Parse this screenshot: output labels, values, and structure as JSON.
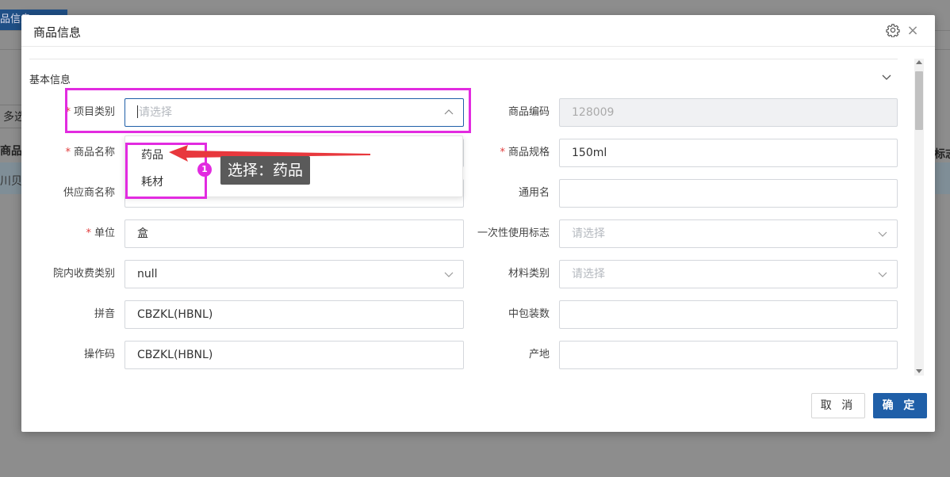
{
  "background": {
    "tab_label": "品信息",
    "multi_label": "多选",
    "header_left": "商品",
    "row_left": "川贝",
    "header_right": "标志"
  },
  "modal": {
    "title": "商品信息",
    "section_title": "基本信息",
    "fields_left": [
      {
        "label": "项目类别",
        "required": true,
        "value": "",
        "placeholder": "请选择",
        "type": "select"
      },
      {
        "label": "商品名称",
        "required": true,
        "value": "",
        "type": "text"
      },
      {
        "label": "供应商名称",
        "required": false,
        "value": "",
        "type": "text"
      },
      {
        "label": "单位",
        "required": true,
        "value": "盒",
        "type": "text"
      },
      {
        "label": "院内收费类别",
        "required": false,
        "value": "null",
        "type": "select"
      },
      {
        "label": "拼音",
        "required": false,
        "value": "CBZKL(HBNL)",
        "type": "text"
      },
      {
        "label": "操作码",
        "required": false,
        "value": "CBZKL(HBNL)",
        "type": "text"
      }
    ],
    "fields_right": [
      {
        "label": "商品编码",
        "required": false,
        "value": "128009",
        "type": "disabled"
      },
      {
        "label": "商品规格",
        "required": true,
        "value": "150ml",
        "type": "text"
      },
      {
        "label": "通用名",
        "required": false,
        "value": "",
        "type": "text"
      },
      {
        "label": "一次性使用标志",
        "required": false,
        "value": "",
        "placeholder": "请选择",
        "type": "select"
      },
      {
        "label": "材料类别",
        "required": false,
        "value": "",
        "placeholder": "请选择",
        "type": "select"
      },
      {
        "label": "中包装数",
        "required": false,
        "value": "",
        "type": "text"
      },
      {
        "label": "产地",
        "required": false,
        "value": "",
        "type": "text"
      }
    ],
    "dropdown_options": [
      "药品",
      "耗材"
    ],
    "footer": {
      "cancel": "取 消",
      "ok": "确 定"
    }
  },
  "annotation": {
    "step": "1",
    "text": "选择：药品"
  },
  "colors": {
    "highlight": "#e22be0",
    "primary": "#1f5fa8",
    "arrow": "#e8383d"
  }
}
